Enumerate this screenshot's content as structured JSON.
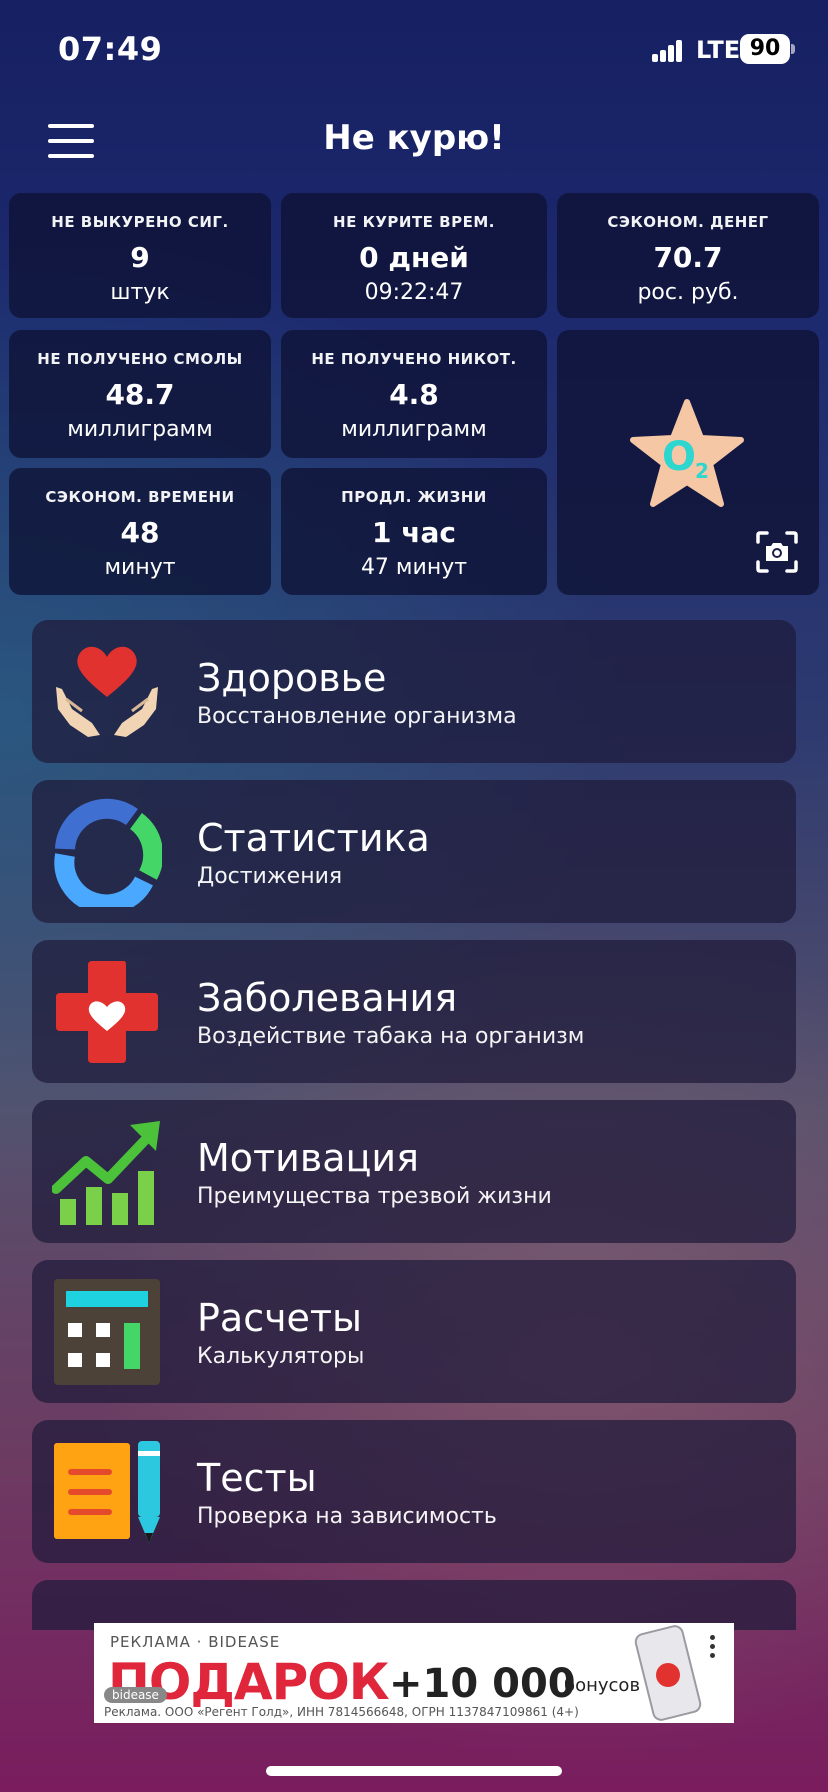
{
  "status_bar": {
    "time": "07:49",
    "network": "LTE",
    "battery": "90"
  },
  "header": {
    "title": "Не курю!",
    "menu_icon": "hamburger-icon"
  },
  "stats": [
    {
      "label": "НЕ ВЫКУРЕНО СИГ.",
      "value": "9",
      "unit": "штук"
    },
    {
      "label": "НЕ КУРИТЕ ВРЕМ.",
      "value": "0 дней",
      "unit": "09:22:47"
    },
    {
      "label": "СЭКОНОМ. ДЕНЕГ",
      "value": "70.7",
      "unit": "рос. руб."
    },
    {
      "label": "НЕ ПОЛУЧЕНО СМОЛЫ",
      "value": "48.7",
      "unit": "миллиграмм"
    },
    {
      "label": "НЕ ПОЛУЧЕНО НИКОТ.",
      "value": "4.8",
      "unit": "миллиграмм"
    },
    {
      "label": "СЭКОНОМ. ВРЕМЕНИ",
      "value": "48",
      "unit": "минут"
    },
    {
      "label": "ПРОДЛ. ЖИЗНИ",
      "value": "1 час",
      "unit": "47 минут"
    }
  ],
  "o2_badge": {
    "text": "O₂",
    "star_color": "#f6c7a4",
    "text_color": "#2dd6cf"
  },
  "menu": [
    {
      "title": "Здоровье",
      "subtitle": "Восстановление организма",
      "icon": "heart-hands-icon"
    },
    {
      "title": "Статистика",
      "subtitle": "Достижения",
      "icon": "donut-chart-icon"
    },
    {
      "title": "Заболевания",
      "subtitle": "Воздействие табака на организм",
      "icon": "medical-cross-icon"
    },
    {
      "title": "Мотивация",
      "subtitle": "Преимущества трезвой жизни",
      "icon": "growth-chart-icon"
    },
    {
      "title": "Расчеты",
      "subtitle": "Калькуляторы",
      "icon": "calculator-icon"
    },
    {
      "title": "Тесты",
      "subtitle": "Проверка на зависимость",
      "icon": "notepad-pencil-icon"
    }
  ],
  "ad": {
    "label": "РЕКЛАМА · BIDEASE",
    "headline": "ПОДАРОК",
    "bonus": "+10 000",
    "bonus_word": "бонусов",
    "brand": "bidease",
    "legal": "Реклама. ООО «Регент Голд», ИНН 7814566648, ОГРН 1137847109861 (4+)"
  },
  "colors": {
    "accent_red": "#e2322f",
    "accent_green": "#45d668",
    "accent_blue": "#3d8ef0"
  }
}
